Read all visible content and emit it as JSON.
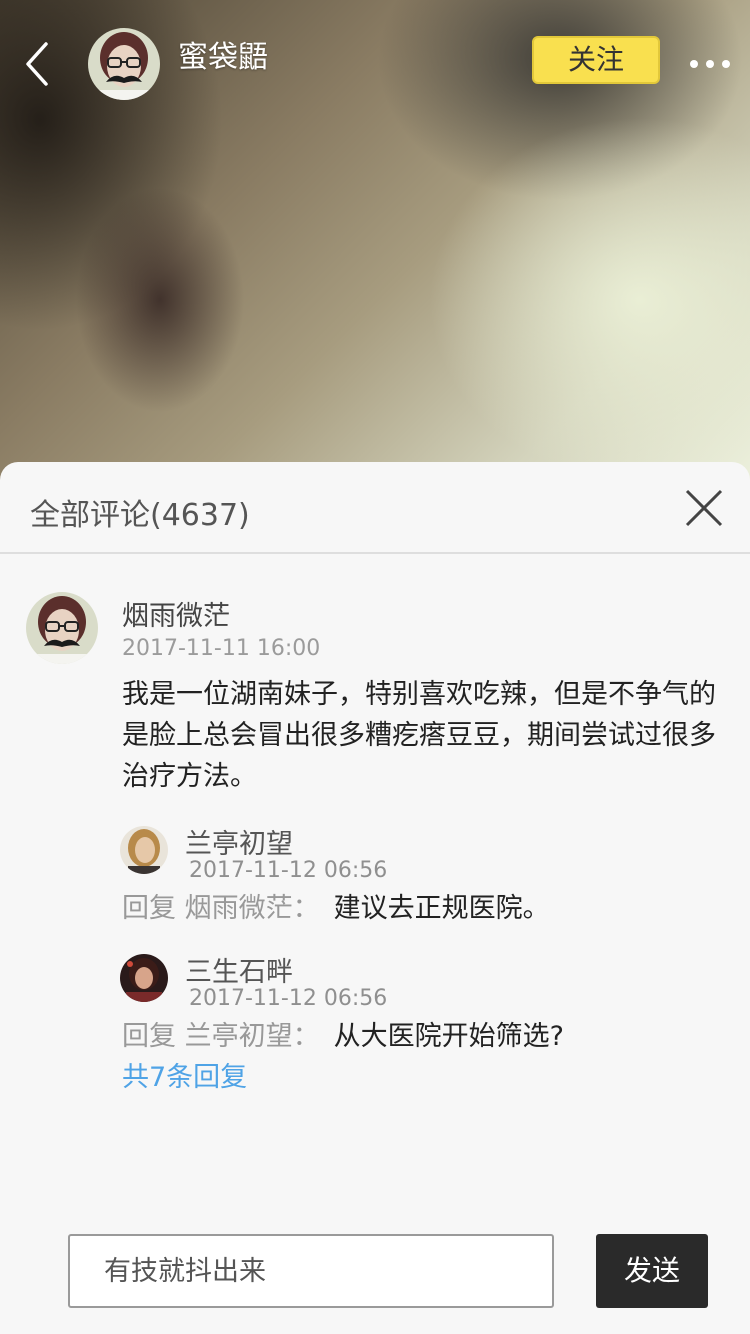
{
  "header": {
    "user_name": "蜜袋鼯",
    "follow_label": "关注",
    "back_icon": "chevron-left-icon",
    "more_icon": "more-dots-icon"
  },
  "comments_panel": {
    "title": "全部评论(4637)",
    "close_icon": "close-icon",
    "comment": {
      "author": "烟雨微茫",
      "time": "2017-11-11 16:00",
      "text": "我是一位湖南妹子，特别喜欢吃辣，但是不争气的是脸上总会冒出很多糟疙瘩豆豆，期间尝试过很多治疗方法。",
      "replies": [
        {
          "author": "兰亭初望",
          "time": "2017-11-12 06:56",
          "prefix": "回复 烟雨微茫：",
          "text": "建议去正规医院。"
        },
        {
          "author": "三生石畔",
          "time": "2017-11-12 06:56",
          "prefix": "回复 兰亭初望：",
          "text": "从大医院开始筛选?"
        }
      ],
      "more_replies_label": "共7条回复"
    }
  },
  "footer": {
    "input_placeholder": "有技就抖出来",
    "send_label": "发送"
  },
  "colors": {
    "follow_bg": "#f9e04f",
    "link": "#4fa3e6",
    "send_bg": "#2a2a2a"
  }
}
